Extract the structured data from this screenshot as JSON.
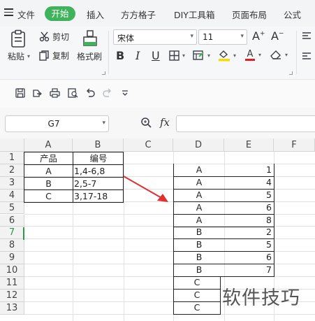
{
  "menu": {
    "file": "文件",
    "active_tab": "开始",
    "tabs": [
      "插入",
      "方方格子",
      "DIY工具箱",
      "页面布局",
      "公式"
    ]
  },
  "ribbon": {
    "paste": "粘贴",
    "cut": "剪切",
    "copy": "复制",
    "format_painter": "格式刷",
    "font_name": "宋体",
    "font_size": "11",
    "bold": "B",
    "italic": "I",
    "underline": "U",
    "font_color": "#e02020",
    "fill_color": "#f5d90a"
  },
  "formula_bar": {
    "name_box": "G7",
    "fx": "fx",
    "formula": ""
  },
  "grid": {
    "columns": [
      "A",
      "B",
      "C",
      "D",
      "E",
      "F"
    ],
    "rows": [
      "1",
      "2",
      "3",
      "4",
      "5",
      "6",
      "7",
      "8",
      "9",
      "10",
      "11",
      "12",
      "13"
    ],
    "active_row": "7",
    "source_table": {
      "header": [
        "产品",
        "编号"
      ],
      "rows": [
        [
          "A",
          "1,4-6,8"
        ],
        [
          "B",
          "2,5-7"
        ],
        [
          "C",
          "3,17-18"
        ]
      ]
    },
    "result_table": [
      [
        "A",
        "1"
      ],
      [
        "A",
        "4"
      ],
      [
        "A",
        "5"
      ],
      [
        "A",
        "6"
      ],
      [
        "A",
        "8"
      ],
      [
        "B",
        "2"
      ],
      [
        "B",
        "5"
      ],
      [
        "B",
        "6"
      ],
      [
        "B",
        "7"
      ],
      [
        "C",
        ""
      ],
      [
        "C",
        ""
      ],
      [
        "C",
        ""
      ]
    ],
    "arrow_color": "#e03030"
  },
  "watermark": "软件技巧"
}
